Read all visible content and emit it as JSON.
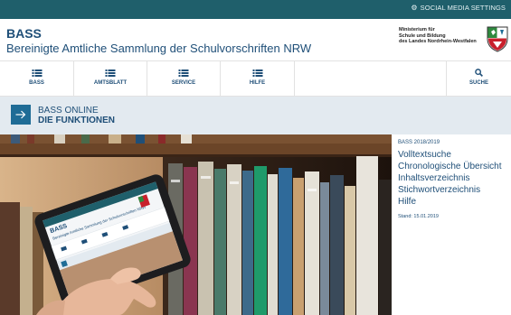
{
  "top_bar": {
    "social_label": "SOCIAL MEDIA SETTINGS"
  },
  "header": {
    "title": "BASS",
    "subtitle": "Bereinigte Amtliche Sammlung der Schulvorschriften NRW",
    "ministry_lines": [
      "Ministerium für",
      "Schule und Bildung",
      "des Landes Nordrhein-Westfalen"
    ]
  },
  "nav": {
    "items": [
      {
        "label": "BASS",
        "icon": "menu-list-icon"
      },
      {
        "label": "AMTSBLATT",
        "icon": "menu-list-icon"
      },
      {
        "label": "SERVICE",
        "icon": "menu-list-icon"
      },
      {
        "label": "HILFE",
        "icon": "menu-list-icon"
      }
    ],
    "search_label": "SUCHE"
  },
  "banner": {
    "line1": "BASS ONLINE",
    "line2": "DIE FUNKTIONEN"
  },
  "panel": {
    "heading": "BASS 2018/2019",
    "links": [
      "Volltextsuche",
      "Chronologische Übersicht",
      "Inhaltsverzeichnis",
      "Stichwortverzeichnis",
      "Hilfe"
    ],
    "date": "Stand: 15.01.2019"
  },
  "tablet": {
    "title": "BASS",
    "subtitle": "Bereinigte Amtliche Sammlung der Schulvorschriften NRW"
  },
  "colors": {
    "brand_blue": "#1f4f78",
    "top_bar": "#1f5f6b",
    "banner_bg": "#e3eaf0",
    "button_blue": "#1f6c96"
  }
}
